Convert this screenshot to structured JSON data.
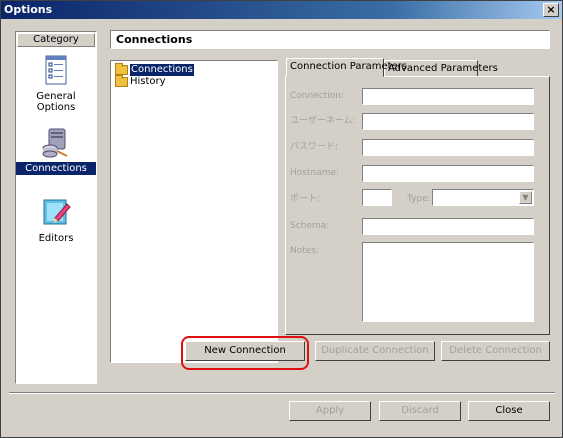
{
  "window": {
    "title": "Options",
    "close_glyph": "×"
  },
  "category": {
    "header": "Category",
    "items": [
      {
        "label": "General Options",
        "icon": "checklist-icon"
      },
      {
        "label": "Connections",
        "icon": "database-server-icon"
      },
      {
        "label": "Editors",
        "icon": "editor-icon"
      }
    ],
    "selected": "Connections"
  },
  "section": {
    "title": "Connections"
  },
  "tree": {
    "items": [
      "Connections",
      "History"
    ],
    "selected": "Connections"
  },
  "tabs": [
    "Connection Parameters",
    "Advanced Parameters"
  ],
  "active_tab": "Connection Parameters",
  "form": {
    "connection_label": "Connection:",
    "username_label": "ユーザーネーム:",
    "password_label": "パスワード:",
    "hostname_label": "Hostname:",
    "port_label": "ポート:",
    "type_label": "Type:",
    "schema_label": "Schema:",
    "notes_label": "Notes:",
    "connection_value": "",
    "username_value": "",
    "password_value": "",
    "hostname_value": "",
    "port_value": "",
    "type_value": "",
    "schema_value": "",
    "notes_value": ""
  },
  "actions": {
    "new_connection": "New Connection",
    "duplicate_connection": "Duplicate Connection",
    "delete_connection": "Delete Connection"
  },
  "footer": {
    "apply": "Apply",
    "discard": "Discard",
    "close": "Close"
  },
  "colors": {
    "highlight_ring": "#e01010",
    "selection": "#0a246a",
    "title_gradient_start": "#0a246a"
  }
}
